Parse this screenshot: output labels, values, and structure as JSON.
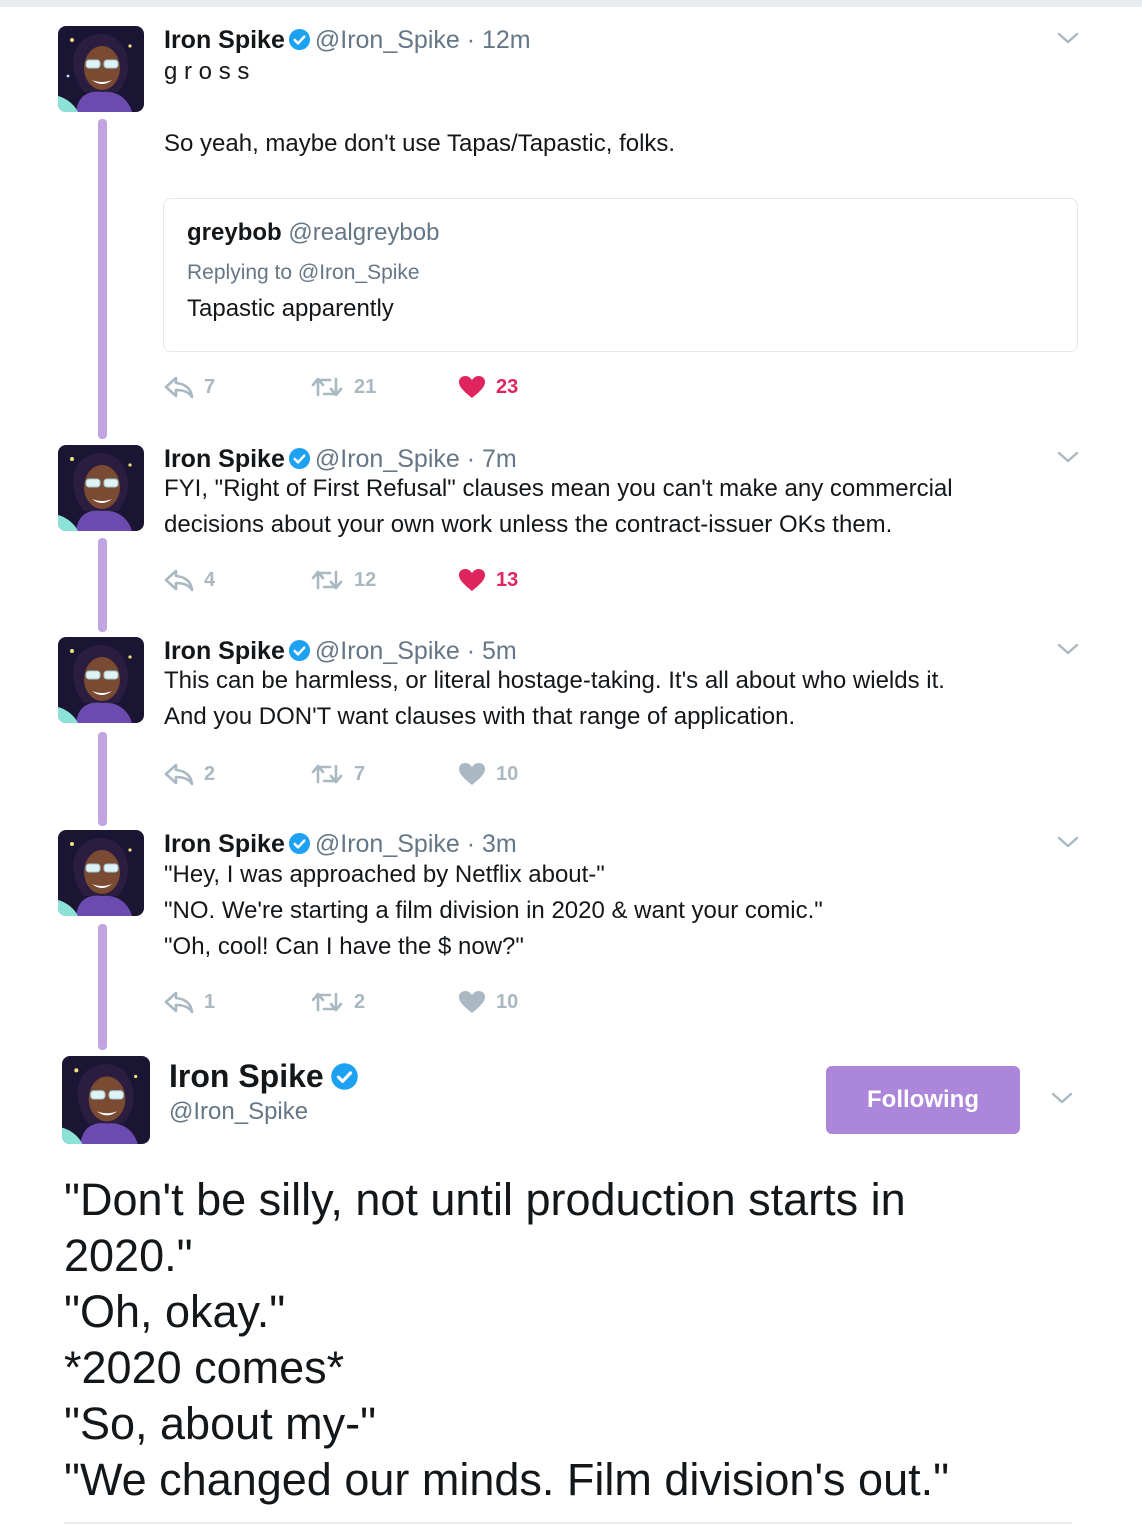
{
  "thread": [
    {
      "name": "Iron Spike",
      "handle": "@Iron_Spike",
      "time": "12m",
      "text": "g r o s s\n\nSo yeah, maybe don't use Tapas/Tapastic, folks.",
      "quoted": {
        "name": "greybob",
        "handle": "@realgreybob",
        "replying_to": "Replying to @Iron_Spike",
        "text": "Tapastic apparently"
      },
      "replies": "7",
      "retweets": "21",
      "likes": "23",
      "liked": true
    },
    {
      "name": "Iron Spike",
      "handle": "@Iron_Spike",
      "time": "7m",
      "text": "FYI, \"Right of First Refusal\" clauses mean you can't make any commercial\ndecisions about your own work unless the contract-issuer OKs them.",
      "replies": "4",
      "retweets": "12",
      "likes": "13",
      "liked": true
    },
    {
      "name": "Iron Spike",
      "handle": "@Iron_Spike",
      "time": "5m",
      "text": "This can be harmless, or literal hostage-taking. It's all about who wields it.\nAnd you DON'T want clauses with that range of application.",
      "replies": "2",
      "retweets": "7",
      "likes": "10",
      "liked": false
    },
    {
      "name": "Iron Spike",
      "handle": "@Iron_Spike",
      "time": "3m",
      "text": "\"Hey, I was approached by Netflix about-\"\n\"NO. We're starting a film division in 2020 & want your comic.\"\n\"Oh, cool! Can I have the $ now?\"",
      "replies": "1",
      "retweets": "2",
      "likes": "10",
      "liked": false
    }
  ],
  "main_tweet": {
    "name": "Iron Spike",
    "handle": "@Iron_Spike",
    "follow_label": "Following",
    "text": "\"Don't be silly, not until production starts in\n2020.\"\n\"Oh, okay.\"\n*2020 comes*\n\"So, about my-\"\n\"We changed our minds. Film division's out.\""
  },
  "colors": {
    "thread_line": "#c1a5e3",
    "follow_button": "#ab86da",
    "like_active": "#e0245e",
    "verified": "#1da1f2",
    "muted": "#657786"
  },
  "icons": [
    "reply-icon",
    "retweet-icon",
    "heart-icon",
    "verified-badge-icon",
    "chevron-down-icon",
    "avatar-image"
  ]
}
